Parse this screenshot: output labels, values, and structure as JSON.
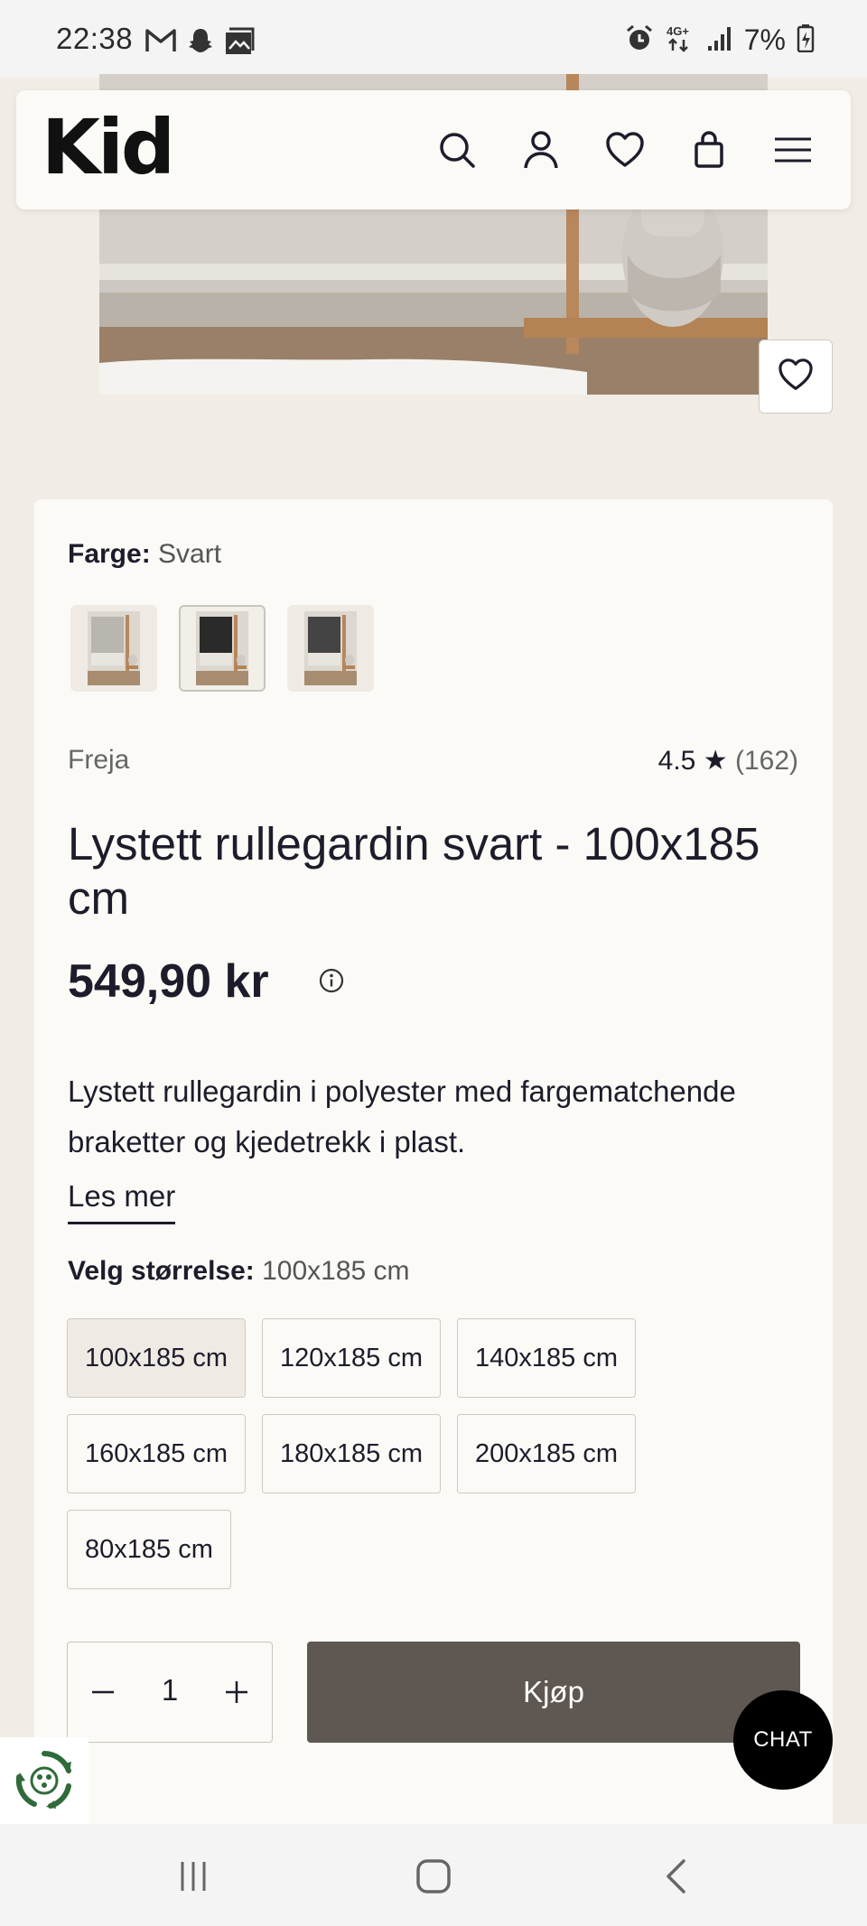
{
  "status_bar": {
    "time": "22:38",
    "left_icons": [
      "gmail-icon",
      "snapchat-icon",
      "gallery-icon"
    ],
    "right_icons": [
      "alarm-icon",
      "network-4g-icon",
      "signal-icon",
      "battery-icon"
    ],
    "battery_text": "7%"
  },
  "header": {
    "logo": "Kid",
    "icons": [
      "search-icon",
      "user-icon",
      "heart-icon",
      "bag-icon",
      "menu-icon"
    ]
  },
  "product": {
    "color_label": "Farge:",
    "color_value": "Svart",
    "swatches": [
      {
        "name": "beige-roller-blind",
        "selected": false,
        "blind_color": "#b9b6b0"
      },
      {
        "name": "black-roller-blind",
        "selected": true,
        "blind_color": "#2a2a2a"
      },
      {
        "name": "dark-grey-roller-blind",
        "selected": false,
        "blind_color": "#444444"
      }
    ],
    "brand": "Freja",
    "rating_value": "4.5",
    "rating_star": "★",
    "rating_count": "(162)",
    "title": "Lystett rullegardin svart - 100x185 cm",
    "price": "549,90 kr",
    "description": "Lystett rullegardin i polyester med fargematchende braketter og kjedetrekk i plast.",
    "read_more": "Les mer",
    "size_label": "Velg størrelse:",
    "size_value": "100x185 cm",
    "sizes": [
      {
        "label": "100x185 cm",
        "selected": true
      },
      {
        "label": "120x185 cm",
        "selected": false
      },
      {
        "label": "140x185 cm",
        "selected": false
      },
      {
        "label": "160x185 cm",
        "selected": false
      },
      {
        "label": "180x185 cm",
        "selected": false
      },
      {
        "label": "200x185 cm",
        "selected": false
      },
      {
        "label": "80x185 cm",
        "selected": false
      }
    ],
    "quantity": "1",
    "buy_label": "Kjøp"
  },
  "chat": {
    "label": "CHAT"
  },
  "nav_bar": {
    "icons": [
      "recent-apps-icon",
      "home-icon",
      "back-icon"
    ]
  },
  "colors": {
    "background": "#f1ede6",
    "card": "#fbfaf6",
    "buy_button": "#5f5751",
    "chat_button": "#000000",
    "text": "#1e1c2b"
  }
}
